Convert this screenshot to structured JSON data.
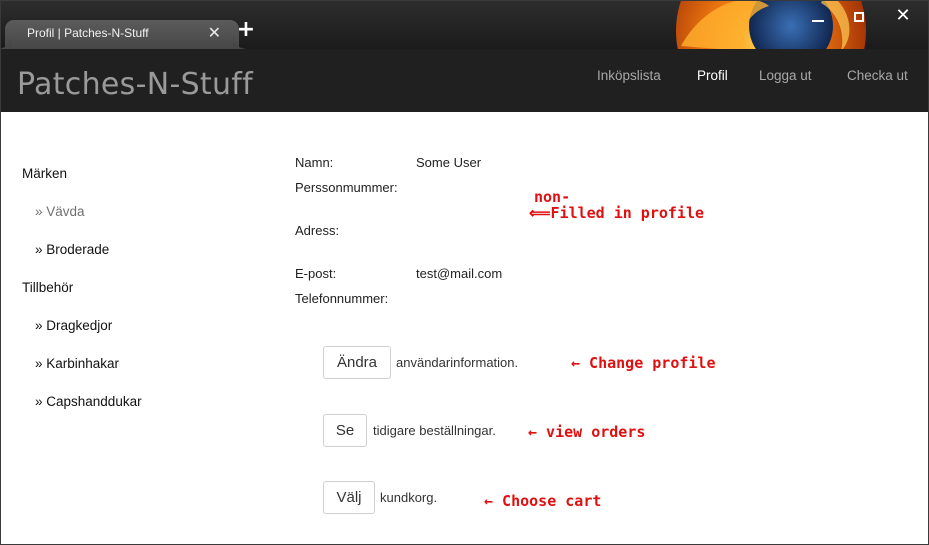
{
  "browser": {
    "tab_title": "Profil | Patches-N-Stuff",
    "tab_close": "✕",
    "new_tab": "+",
    "close_glyph": "✕"
  },
  "site": {
    "brand": "Patches-N-Stuff",
    "nav": [
      "Inköpslista",
      "Profil",
      "Logga ut",
      "Checka ut"
    ],
    "active_nav": "Profil"
  },
  "sidebar": {
    "categories": [
      {
        "title": "Märken",
        "items": [
          "» Vävda",
          "» Broderade"
        ]
      },
      {
        "title": "Tillbehör",
        "items": [
          "» Dragkedjor",
          "» Karbinhakar",
          "» Capshanddukar"
        ]
      }
    ]
  },
  "profile": {
    "name_label": "Namn:",
    "name_value": "Some User",
    "ssn_label": "Perssonmummer:",
    "ssn_value": "",
    "address_label": "Adress:",
    "address_value": "",
    "email_label": "E-post:",
    "email_value": "test@mail.com",
    "phone_label": "Telefonnummer:",
    "phone_value": ""
  },
  "actions": {
    "change_button": "Ändra",
    "change_text": "användarinformation.",
    "view_button": "Se",
    "view_text": "tidigare beställningar.",
    "cart_button": "Välj",
    "cart_text": "kundkorg."
  },
  "annotations": {
    "non_prefix": "non-",
    "filled_in_profile": "⟸Filled in profile",
    "change_profile": "←  Change profile",
    "view_orders": "←  view orders",
    "choose_cart": "←  Choose cart"
  },
  "colors": {
    "header_bg": "#202020",
    "annotation": "#e01010",
    "brand_text": "#9a9a9a"
  },
  "icons": [
    "firefox-logo-icon",
    "minimize-icon",
    "maximize-icon",
    "close-icon",
    "tab-close-icon",
    "new-tab-icon"
  ]
}
